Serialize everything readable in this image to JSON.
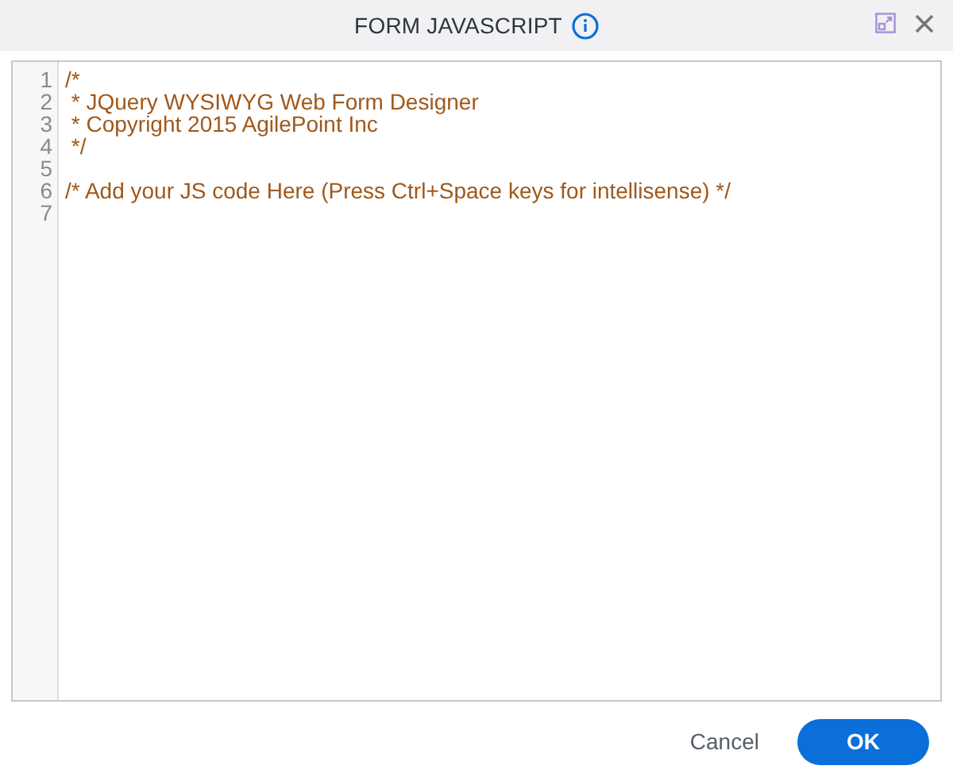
{
  "dialog": {
    "title": "FORM JAVASCRIPT"
  },
  "editor": {
    "lines": [
      {
        "number": "1",
        "text": "/*"
      },
      {
        "number": "2",
        "text": " * JQuery WYSIWYG Web Form Designer"
      },
      {
        "number": "3",
        "text": " * Copyright 2015 AgilePoint Inc"
      },
      {
        "number": "4",
        "text": " */"
      },
      {
        "number": "5"
      },
      {
        "number": "6",
        "text": "/* Add your JS code Here (Press Ctrl+Space keys for intellisense) */"
      },
      {
        "number": "7"
      }
    ]
  },
  "buttons": [
    {
      "label": "Cancel",
      "kind": "secondary"
    },
    {
      "label": "OK",
      "kind": "primary"
    }
  ]
}
